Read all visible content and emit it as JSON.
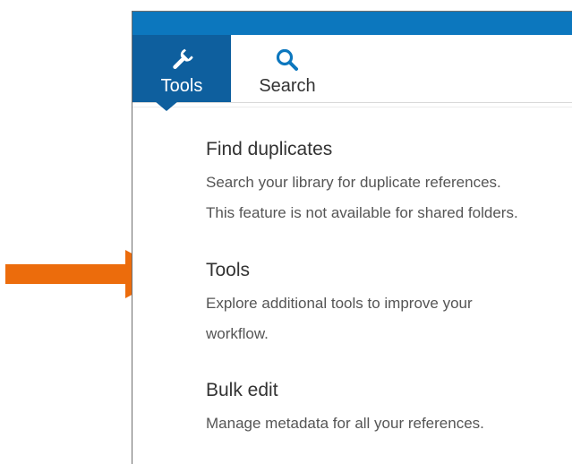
{
  "arrow": {
    "color": "#ec6c0c"
  },
  "header": {
    "bar_color": "#0c77be",
    "tabs": [
      {
        "label": "Tools",
        "icon": "wrench-icon",
        "active": true
      },
      {
        "label": "Search",
        "icon": "search-icon",
        "active": false
      }
    ]
  },
  "sections": [
    {
      "title": "Find duplicates",
      "description_lines": [
        "Search your library for duplicate references.",
        "This feature is not available for shared folders."
      ]
    },
    {
      "title": "Tools",
      "description_lines": [
        "Explore additional tools to improve your",
        "workflow."
      ]
    },
    {
      "title": "Bulk edit",
      "description_lines": [
        "Manage metadata for all your references."
      ]
    }
  ]
}
